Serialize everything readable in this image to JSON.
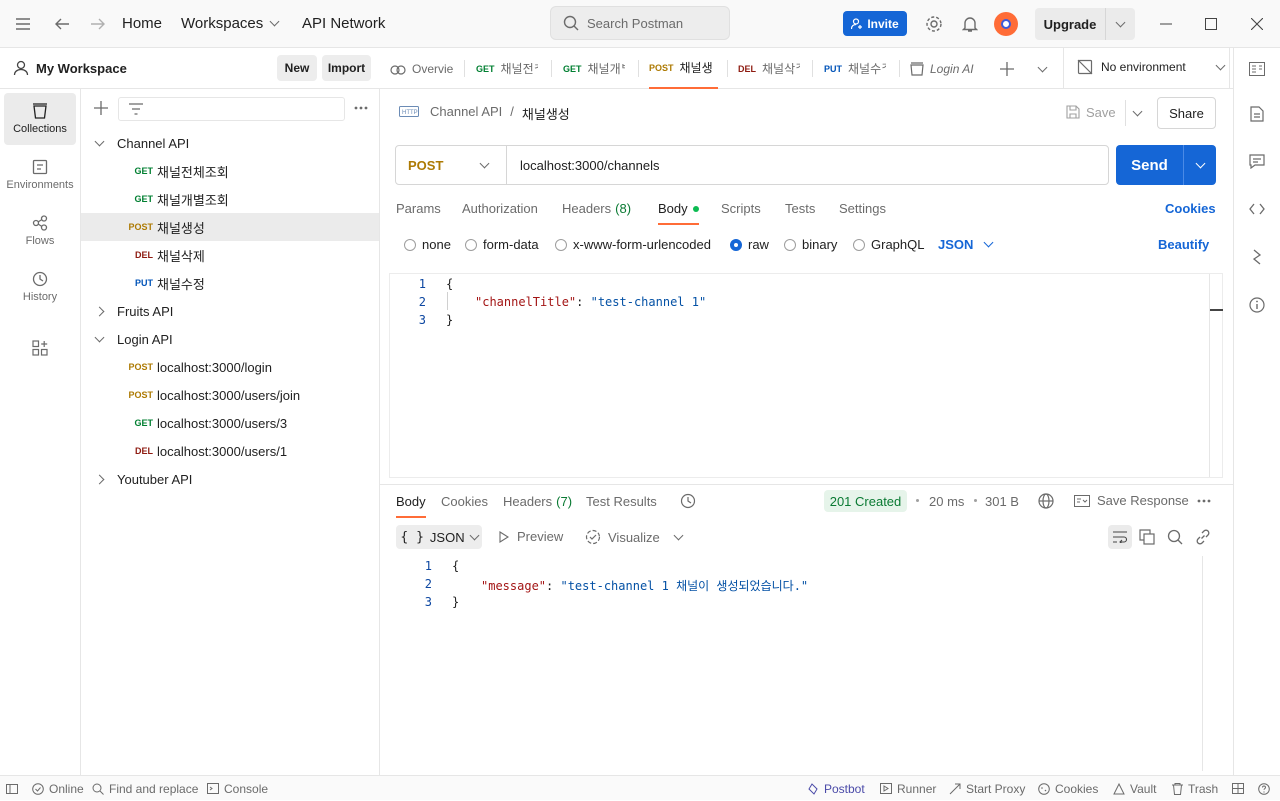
{
  "titlebar": {
    "home": "Home",
    "workspaces": "Workspaces",
    "api_network": "API Network",
    "search_placeholder": "Search Postman",
    "invite": "Invite",
    "upgrade": "Upgrade"
  },
  "workspace": {
    "name": "My Workspace",
    "new_btn": "New",
    "import_btn": "Import"
  },
  "leftbar": [
    {
      "label": "Collections",
      "icon": "collections-icon",
      "active": true
    },
    {
      "label": "Environments",
      "icon": "environments-icon",
      "active": false
    },
    {
      "label": "Flows",
      "icon": "flows-icon",
      "active": false
    },
    {
      "label": "History",
      "icon": "history-icon",
      "active": false
    }
  ],
  "tree": {
    "channel_api": "Channel API",
    "channel_items": [
      {
        "method": "GET",
        "label": "채널전체조회"
      },
      {
        "method": "GET",
        "label": "채널개별조회"
      },
      {
        "method": "POST",
        "label": "채널생성"
      },
      {
        "method": "DEL",
        "label": "채널삭제"
      },
      {
        "method": "PUT",
        "label": "채널수정"
      }
    ],
    "fruits_api": "Fruits API",
    "login_api": "Login API",
    "login_items": [
      {
        "method": "POST",
        "label": "localhost:3000/login"
      },
      {
        "method": "POST",
        "label": "localhost:3000/users/join"
      },
      {
        "method": "GET",
        "label": "localhost:3000/users/3"
      },
      {
        "method": "DEL",
        "label": "localhost:3000/users/1"
      }
    ],
    "youtuber_api": "Youtuber API"
  },
  "tabs": [
    {
      "method": "",
      "label": "Overvie"
    },
    {
      "method": "GET",
      "label": "채널전ᄎ"
    },
    {
      "method": "GET",
      "label": "채널개ᄇ"
    },
    {
      "method": "POST",
      "label": "채널생"
    },
    {
      "method": "DEL",
      "label": "채널삭ᄌ"
    },
    {
      "method": "PUT",
      "label": "채널수ᄌ"
    },
    {
      "method": "",
      "label": "Login AI"
    }
  ],
  "environment": "No environment",
  "request": {
    "breadcrumb_parent": "Channel API",
    "breadcrumb_sep": "/",
    "title": "채널생성",
    "save": "Save",
    "share": "Share",
    "method": "POST",
    "url": "localhost:3000/channels",
    "send": "Send",
    "subtabs": [
      "Params",
      "Authorization",
      "Headers",
      "(8)",
      "Body",
      "Scripts",
      "Tests",
      "Settings"
    ],
    "cookies": "Cookies",
    "body_modes": [
      "none",
      "form-data",
      "x-www-form-urlencoded",
      "raw",
      "binary",
      "GraphQL"
    ],
    "format": "JSON",
    "beautify": "Beautify",
    "code_lines": [
      "{",
      "\"channelTitle\"",
      ": ",
      "\"test-channel 1\"",
      "}"
    ]
  },
  "response": {
    "tabs": [
      "Body",
      "Cookies",
      "Headers",
      "(7)",
      "Test Results"
    ],
    "status": "201 Created",
    "time": "20 ms",
    "size": "301 B",
    "save_response": "Save Response",
    "format": "JSON",
    "preview": "Preview",
    "visualize": "Visualize",
    "code_lines": [
      "{",
      "\"message\"",
      ": ",
      "\"test-channel 1 채널이 생성되었습니다.\"",
      "}"
    ]
  },
  "statusbar": {
    "online": "Online",
    "find_replace": "Find and replace",
    "console": "Console",
    "postbot": "Postbot",
    "runner": "Runner",
    "start_proxy": "Start Proxy",
    "cookies": "Cookies",
    "vault": "Vault",
    "trash": "Trash"
  },
  "colors": {
    "accent": "#ff6c37",
    "primary": "#1566d6",
    "success": "#0a7a33"
  }
}
